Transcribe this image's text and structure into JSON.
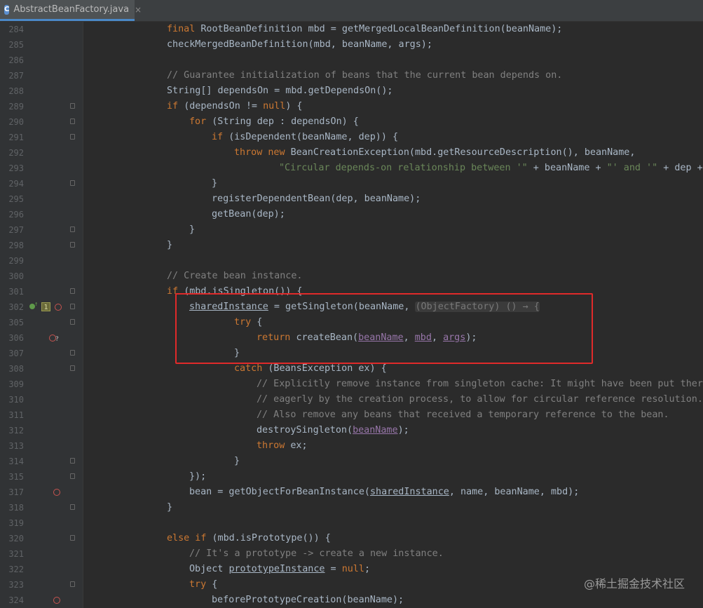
{
  "tab": {
    "label": "AbstractBeanFactory.java",
    "close": "×",
    "icon": "java-class-icon"
  },
  "watermark": "@稀土掘金技术社区",
  "lines": [
    {
      "n": "284",
      "segs": [
        [
          "t",
          "final "
        ],
        [
          "p",
          "RootBeanDefinition mbd = getMergedLocalBeanDefinition(beanName);"
        ]
      ]
    },
    {
      "n": "285",
      "segs": [
        [
          "p",
          "checkMergedBeanDefinition(mbd, beanName, args);"
        ]
      ]
    },
    {
      "n": "286",
      "segs": []
    },
    {
      "n": "287",
      "segs": [
        [
          "c",
          "// Guarantee initialization of beans that the current bean depends on."
        ]
      ]
    },
    {
      "n": "288",
      "segs": [
        [
          "p",
          "String[] dependsOn = mbd.getDependsOn();"
        ]
      ]
    },
    {
      "n": "289",
      "segs": [
        [
          "k",
          "if "
        ],
        [
          "p",
          "(dependsOn != "
        ],
        [
          "k",
          "null"
        ],
        [
          "p",
          ") {"
        ]
      ]
    },
    {
      "n": "290",
      "segs": [
        [
          "k",
          "for "
        ],
        [
          "p",
          "(String dep : dependsOn) {"
        ]
      ]
    },
    {
      "n": "291",
      "segs": [
        [
          "k",
          "if "
        ],
        [
          "p",
          "(isDependent(beanName, dep)) {"
        ]
      ]
    },
    {
      "n": "292",
      "segs": [
        [
          "k",
          "throw new "
        ],
        [
          "p",
          "BeanCreationException(mbd.getResourceDescription(), beanName,"
        ]
      ]
    },
    {
      "n": "293",
      "segs": [
        [
          "s",
          "\"Circular depends-on relationship between '\""
        ],
        [
          "p",
          " + beanName + "
        ],
        [
          "s",
          "\"' and '\""
        ],
        [
          "p",
          " + dep + "
        ]
      ]
    },
    {
      "n": "294",
      "segs": [
        [
          "p",
          "}"
        ]
      ]
    },
    {
      "n": "295",
      "segs": [
        [
          "p",
          "registerDependentBean(dep, beanName);"
        ]
      ]
    },
    {
      "n": "296",
      "segs": [
        [
          "p",
          "getBean(dep);"
        ]
      ]
    },
    {
      "n": "297",
      "segs": [
        [
          "p",
          "}"
        ]
      ]
    },
    {
      "n": "298",
      "segs": [
        [
          "p",
          "}"
        ]
      ]
    },
    {
      "n": "299",
      "segs": []
    },
    {
      "n": "300",
      "segs": [
        [
          "c",
          "// Create bean instance."
        ]
      ]
    },
    {
      "n": "301",
      "segs": [
        [
          "k",
          "if "
        ],
        [
          "p",
          "(mbd.isSingleton()) {"
        ]
      ]
    },
    {
      "n": "302",
      "segs": [
        [
          "u",
          "sharedInstance"
        ],
        [
          "p",
          " = getSingleton(beanName, "
        ],
        [
          "h",
          "(ObjectFactory) () → {"
        ]
      ]
    },
    {
      "n": "305",
      "segs": [
        [
          "k",
          "try "
        ],
        [
          "p",
          "{"
        ]
      ]
    },
    {
      "n": "306",
      "segs": [
        [
          "k",
          "return "
        ],
        [
          "p",
          "createBean("
        ],
        [
          "pu",
          "beanName"
        ],
        [
          "p",
          ", "
        ],
        [
          "pu",
          "mbd"
        ],
        [
          "p",
          ", "
        ],
        [
          "pu",
          "args"
        ],
        [
          "p",
          ");"
        ]
      ]
    },
    {
      "n": "307",
      "segs": [
        [
          "p",
          "}"
        ]
      ]
    },
    {
      "n": "308",
      "segs": [
        [
          "k",
          "catch "
        ],
        [
          "p",
          "(BeansException ex) {"
        ]
      ]
    },
    {
      "n": "309",
      "segs": [
        [
          "c",
          "// Explicitly remove instance from singleton cache: It might have been put there"
        ]
      ]
    },
    {
      "n": "310",
      "segs": [
        [
          "c",
          "// eagerly by the creation process, to allow for circular reference resolution."
        ]
      ]
    },
    {
      "n": "311",
      "segs": [
        [
          "c",
          "// Also remove any beans that received a temporary reference to the bean."
        ]
      ]
    },
    {
      "n": "312",
      "segs": [
        [
          "p",
          "destroySingleton("
        ],
        [
          "pu",
          "beanName"
        ],
        [
          "p",
          ");"
        ]
      ]
    },
    {
      "n": "313",
      "segs": [
        [
          "k",
          "throw "
        ],
        [
          "p",
          "ex;"
        ]
      ]
    },
    {
      "n": "314",
      "segs": [
        [
          "p",
          "}"
        ]
      ]
    },
    {
      "n": "315",
      "segs": [
        [
          "p",
          "});"
        ]
      ]
    },
    {
      "n": "317",
      "segs": [
        [
          "p",
          "bean = getObjectForBeanInstance("
        ],
        [
          "u",
          "sharedInstance"
        ],
        [
          "p",
          ", name, beanName, mbd);"
        ]
      ]
    },
    {
      "n": "318",
      "segs": [
        [
          "p",
          "}"
        ]
      ]
    },
    {
      "n": "319",
      "segs": []
    },
    {
      "n": "320",
      "segs": [
        [
          "k",
          "else if "
        ],
        [
          "p",
          "(mbd.isPrototype()) {"
        ]
      ]
    },
    {
      "n": "321",
      "segs": [
        [
          "c",
          "// It's a prototype -> create a new instance."
        ]
      ]
    },
    {
      "n": "322",
      "segs": [
        [
          "p",
          "Object "
        ],
        [
          "u",
          "prototypeInstance"
        ],
        [
          "p",
          " = "
        ],
        [
          "k",
          "null"
        ],
        [
          "p",
          ";"
        ]
      ]
    },
    {
      "n": "323",
      "segs": [
        [
          "k",
          "try "
        ],
        [
          "p",
          "{"
        ]
      ]
    },
    {
      "n": "324",
      "segs": [
        [
          "p",
          "beforePrototypeCreation(beanName);"
        ]
      ]
    }
  ]
}
